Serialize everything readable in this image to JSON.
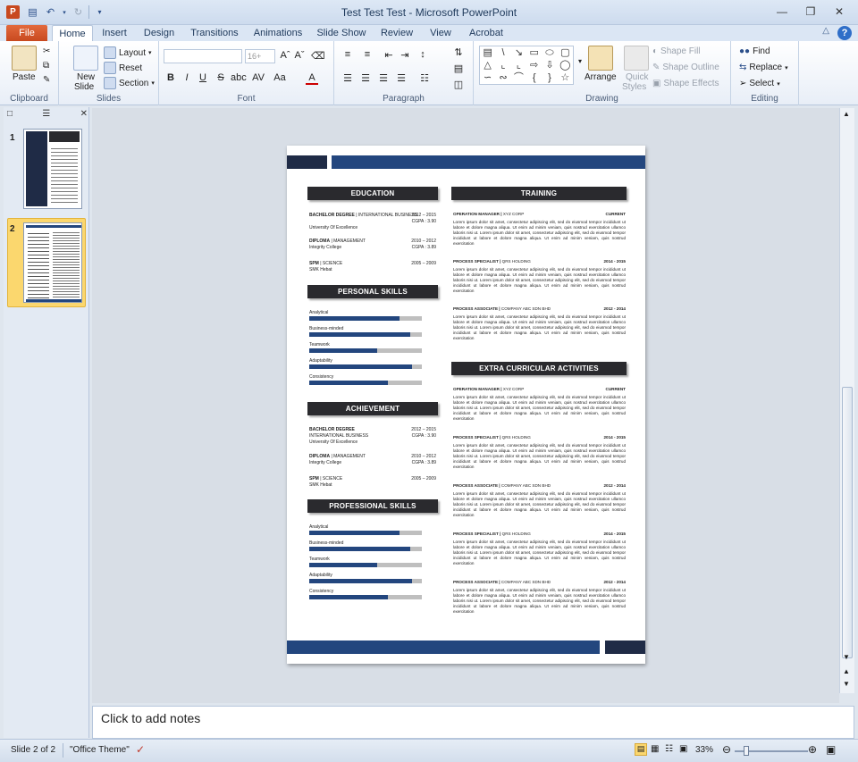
{
  "window": {
    "title": "Test Test Test - Microsoft PowerPoint",
    "app_icon_letter": "P"
  },
  "ribbon_tabs": [
    "File",
    "Home",
    "Insert",
    "Design",
    "Transitions",
    "Animations",
    "Slide Show",
    "Review",
    "View",
    "Acrobat"
  ],
  "active_tab": "Home",
  "ribbon": {
    "clipboard": {
      "label": "Clipboard",
      "paste": "Paste"
    },
    "slides": {
      "label": "Slides",
      "new_slide_line1": "New",
      "new_slide_line2": "Slide",
      "layout": "Layout",
      "reset": "Reset",
      "section": "Section"
    },
    "font": {
      "label": "Font",
      "size": "16+"
    },
    "paragraph": {
      "label": "Paragraph"
    },
    "drawing": {
      "label": "Drawing",
      "arrange": "Arrange",
      "quick_styles_line1": "Quick",
      "quick_styles_line2": "Styles",
      "shape_fill": "Shape Fill",
      "shape_outline": "Shape Outline",
      "shape_effects": "Shape Effects"
    },
    "editing": {
      "label": "Editing",
      "find": "Find",
      "replace": "Replace",
      "select": "Select"
    }
  },
  "slides_panel": {
    "thumbs": [
      "1",
      "2"
    ],
    "selected": "2"
  },
  "resume": {
    "education": {
      "title": "EDUCATION",
      "entries": [
        {
          "degree": "BACHELOR DEGREE",
          "field": "INTERNATIONAL BUSINESS",
          "school": "University Of Excellence",
          "years": "2012 – 2015",
          "grade": "CGPA : 3.90"
        },
        {
          "degree": "DIPLOMA",
          "field": "MANAGEMENT",
          "school": "Integrity College",
          "years": "2010 – 2012",
          "grade": "CGPA : 3.89"
        },
        {
          "degree": "SPM",
          "field": "SCIENCE",
          "school": "SMK Hebat",
          "years": "2005 – 2009",
          "grade": ""
        }
      ]
    },
    "personal_skills": {
      "title": "PERSONAL SKILLS",
      "skills": [
        {
          "name": "Analytical",
          "level": 0.8
        },
        {
          "name": "Business-minded",
          "level": 0.9
        },
        {
          "name": "Teamwork",
          "level": 0.6
        },
        {
          "name": "Adaptability",
          "level": 0.91
        },
        {
          "name": "Consistency",
          "level": 0.7
        }
      ]
    },
    "achievement": {
      "title": "ACHIEVEMENT",
      "entries": [
        {
          "degree": "BACHELOR DEGREE",
          "field": "INTERNATIONAL BUSINESS",
          "school": "University Of Excellence",
          "years": "2012 – 2015",
          "grade": "CGPA : 3.90"
        },
        {
          "degree": "DIPLOMA",
          "field": "MANAGEMENT",
          "school": "Integrity College",
          "years": "2010 – 2012",
          "grade": "CGPA : 3.89"
        },
        {
          "degree": "SPM",
          "field": "SCIENCE",
          "school": "SMK Hebat",
          "years": "2005 – 2009",
          "grade": ""
        }
      ]
    },
    "professional_skills": {
      "title": "PROFESSIONAL SKILLS",
      "skills": [
        {
          "name": "Analytical",
          "level": 0.8
        },
        {
          "name": "Business-minded",
          "level": 0.9
        },
        {
          "name": "Teamwork",
          "level": 0.6
        },
        {
          "name": "Adaptability",
          "level": 0.91
        },
        {
          "name": "Consistency",
          "level": 0.7
        }
      ]
    },
    "lorem": "Lorem ipsum dolor sit amet, consectetur adipiscing elit, sed do eiusmod tempor incididunt ut labore et dolore magna aliqua. Ut enim ad minim veniam, quis nostrud exercitation ullamco laboris nisi ut. Lorem ipsum dolor sit amet, consectetur adipiscing elit, sed do eiusmod tempor incididunt ut labore et dolore magna aliqua. Ut enim ad minim veniam, quis nostrud exercitation",
    "training": {
      "title": "TRAINING",
      "jobs": [
        {
          "role": "OPERATION MANAGER",
          "company": "XYZ CORP",
          "period": "CURRENT"
        },
        {
          "role": "PROCESS SPECIALIST",
          "company": "QRS HOLDING",
          "period": "2014 - 2015"
        },
        {
          "role": "PROCESS ASSOCIATE",
          "company": "COMPANY ABC SDN BHD",
          "period": "2012 - 2014"
        }
      ]
    },
    "extra": {
      "title": "EXTRA CURRICULAR ACTIVITIES",
      "jobs": [
        {
          "role": "OPERATION MANAGER",
          "company": "XYZ CORP",
          "period": "CURRENT"
        },
        {
          "role": "PROCESS SPECIALIST",
          "company": "QRS HOLDING",
          "period": "2014 - 2015"
        },
        {
          "role": "PROCESS ASSOCIATE",
          "company": "COMPANY ABC SDN BHD",
          "period": "2012 - 2014"
        },
        {
          "role": "PROCESS SPECIALIST",
          "company": "QRS HOLDING",
          "period": "2014 - 2015"
        },
        {
          "role": "PROCESS ASSOCIATE",
          "company": "COMPANY ABC SDN BHD",
          "period": "2012 - 2014"
        }
      ]
    }
  },
  "notes_placeholder": "Click to add notes",
  "status": {
    "slide": "Slide 2 of 2",
    "theme": "\"Office Theme\"",
    "zoom": "33%"
  },
  "colors": {
    "navy": "#23467e",
    "dark": "#2a2a2e",
    "band_dark": "#1f2b46"
  }
}
